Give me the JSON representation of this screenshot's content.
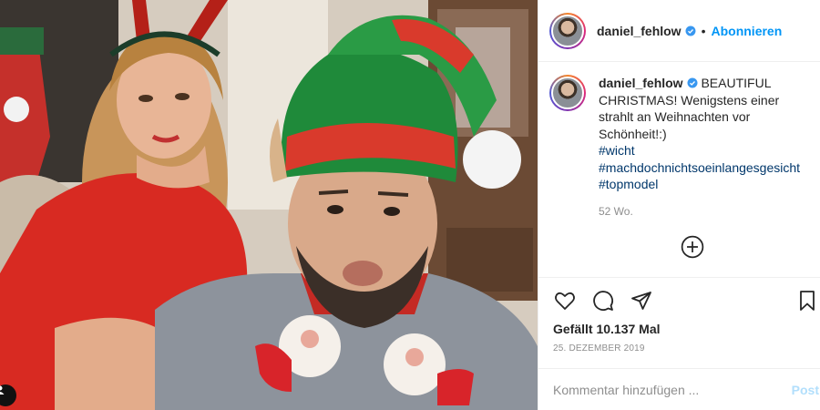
{
  "post": {
    "username": "daniel_fehlow",
    "verified_icon": "verified-badge-icon",
    "follow_label": "Abonnieren",
    "separator": "•",
    "caption": {
      "text": "BEAUTIFUL CHRISTMAS! Wenigstens einer strahlt an Weihnachten vor Schönheit!:)",
      "hashtags": [
        "#wicht",
        "#machdochnichtsoeinlangesgesicht",
        "#topmodel"
      ]
    },
    "time_ago": "52 Wo.",
    "likes": "Gefällt 10.137 Mal",
    "date": "25. Dezember 2019",
    "comment_placeholder": "Kommentar hinzufügen ...",
    "post_label": "Post"
  },
  "icons": {
    "like": "heart-icon",
    "comment": "comment-bubble-icon",
    "share": "paper-plane-icon",
    "save": "bookmark-icon",
    "load_more": "plus-circle-icon",
    "tag": "user-tag-icon"
  },
  "colors": {
    "link": "#0095f6",
    "hashtag": "#00376b",
    "muted": "#8e8e8e",
    "post_disabled": "#b2dffc"
  }
}
